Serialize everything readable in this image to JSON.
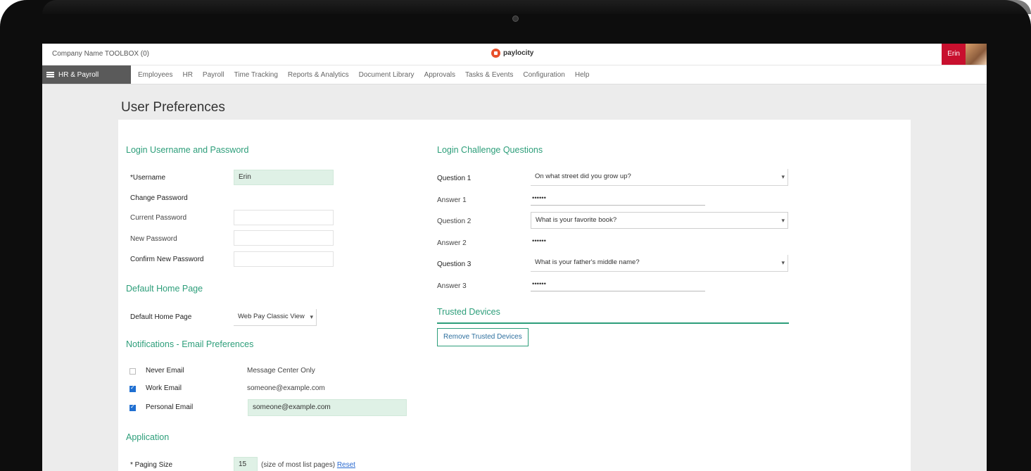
{
  "topbar": {
    "company": "Company Name TOOLBOX (0)",
    "brand": "paylocity",
    "user_name": "Erin"
  },
  "nav": {
    "home_label": "HR & Payroll",
    "items": [
      "Employees",
      "HR",
      "Payroll",
      "Time Tracking",
      "Reports & Analytics",
      "Document Library",
      "Approvals",
      "Tasks & Events",
      "Configuration",
      "Help"
    ]
  },
  "page": {
    "title": "User Preferences"
  },
  "login": {
    "section": "Login Username and Password",
    "username_label": "*Username",
    "username_value": "Erin",
    "change_password_label": "Change Password",
    "current_password_label": "Current Password",
    "new_password_label": "New Password",
    "confirm_password_label": "Confirm New Password"
  },
  "home_page": {
    "section": "Default Home Page",
    "label": "Default Home Page",
    "value": "Web Pay Classic View"
  },
  "notifications": {
    "section": "Notifications - Email Preferences",
    "never_email_label": "Never Email",
    "never_email_value": "Message Center Only",
    "work_email_label": "Work Email",
    "work_email_value": "someone@example.com",
    "personal_email_label": "Personal Email",
    "personal_email_value": "someone@example.com"
  },
  "application": {
    "section": "Application",
    "paging_size_label": "* Paging Size",
    "paging_size_value": "15",
    "paging_hint": "(size of most list pages)",
    "paging_link": "Reset"
  },
  "challenge": {
    "section": "Login Challenge Questions",
    "q1_label": "Question 1",
    "q1_value": "On what street did you grow up?",
    "a1_label": "Answer 1",
    "a1_value": "••••••",
    "q2_label": "Question 2",
    "q2_value": "What is your favorite book?",
    "a2_label": "Answer 2",
    "a2_value": "••••••",
    "q3_label": "Question 3",
    "q3_value": "What is your father's middle name?",
    "a3_label": "Answer 3",
    "a3_value": "••••••"
  },
  "trusted": {
    "section": "Trusted Devices",
    "button": "Remove Trusted Devices"
  },
  "icons": {
    "menu": "hamburger-menu-icon",
    "chevron": "chevron-down-icon",
    "checkbox": "checkbox-icon"
  },
  "colors": {
    "accent_green": "#2d9e7a",
    "brand_red": "#c8102e",
    "checkbox_blue": "#1f6fd1"
  }
}
